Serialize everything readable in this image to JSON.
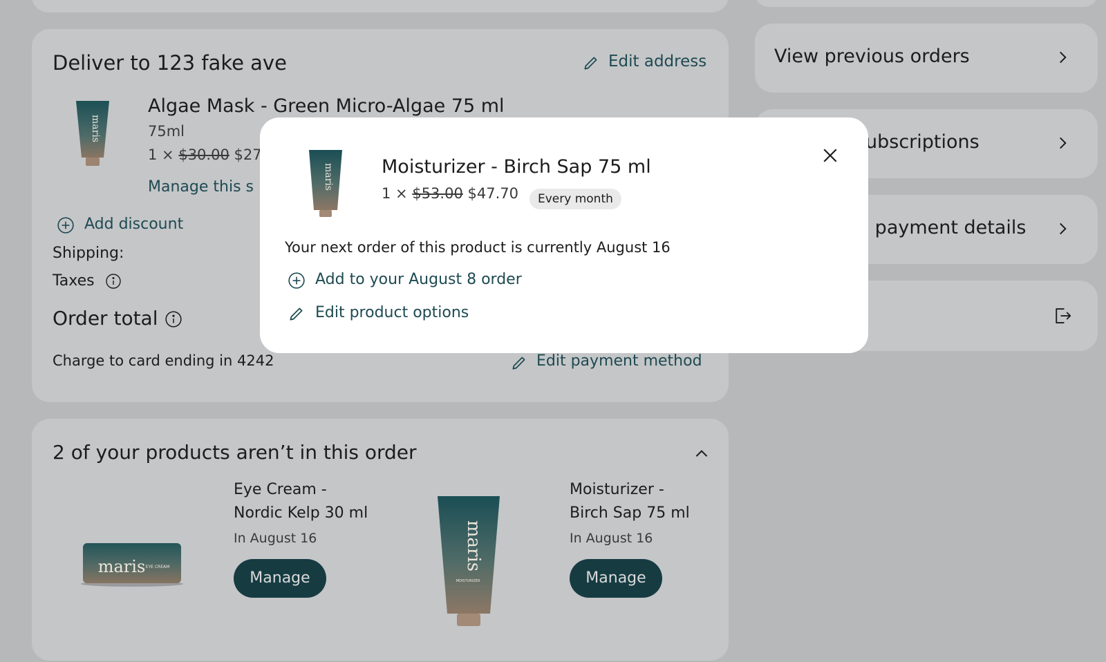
{
  "delivery": {
    "title": "Deliver to 123 fake ave",
    "edit_address": "Edit address",
    "item": {
      "name": "Algae Mask - Green Micro-Algae 75 ml",
      "size": "75ml",
      "qty_prefix": "1 ×",
      "old_price": "$30.00",
      "new_price": "$27",
      "manage": "Manage this s"
    },
    "add_discount": "Add discount",
    "shipping_label": "Shipping:",
    "taxes_label": "Taxes",
    "order_total_label": "Order total",
    "charge_text": "Charge to card ending in 4242",
    "edit_payment": "Edit payment method"
  },
  "missing_products": {
    "title": "2 of your products aren’t in this order",
    "products": [
      {
        "name_line1": "Eye Cream -",
        "name_line2": "Nordic Kelp 30 ml",
        "date": "In August 16",
        "button": "Manage",
        "brand": "maris",
        "sub": "EYE CREAM"
      },
      {
        "name_line1": "Moisturizer -",
        "name_line2": "Birch Sap 75 ml",
        "date": "In August 16",
        "button": "Manage",
        "brand": "maris",
        "sub": "MOISTURIZER"
      }
    ]
  },
  "sidebar": {
    "view_previous_orders": "View previous orders",
    "subscriptions": "ubscriptions",
    "payment_details": "; payment details"
  },
  "modal": {
    "product_name": "Moisturizer - Birch Sap 75 ml",
    "qty_prefix": "1 ×",
    "old_price": "$53.00",
    "new_price": "$47.70",
    "frequency": "Every month",
    "next_order_text": "Your next order of this product is currently August 16",
    "add_to_order": "Add to your August 8 order",
    "edit_options": "Edit product options",
    "brand": "maris"
  },
  "colors": {
    "background": "#b7b8ba",
    "card": "#c5c6c8",
    "accent_teal": "#1e4a52",
    "button": "#163c42",
    "modal": "#ffffff"
  }
}
